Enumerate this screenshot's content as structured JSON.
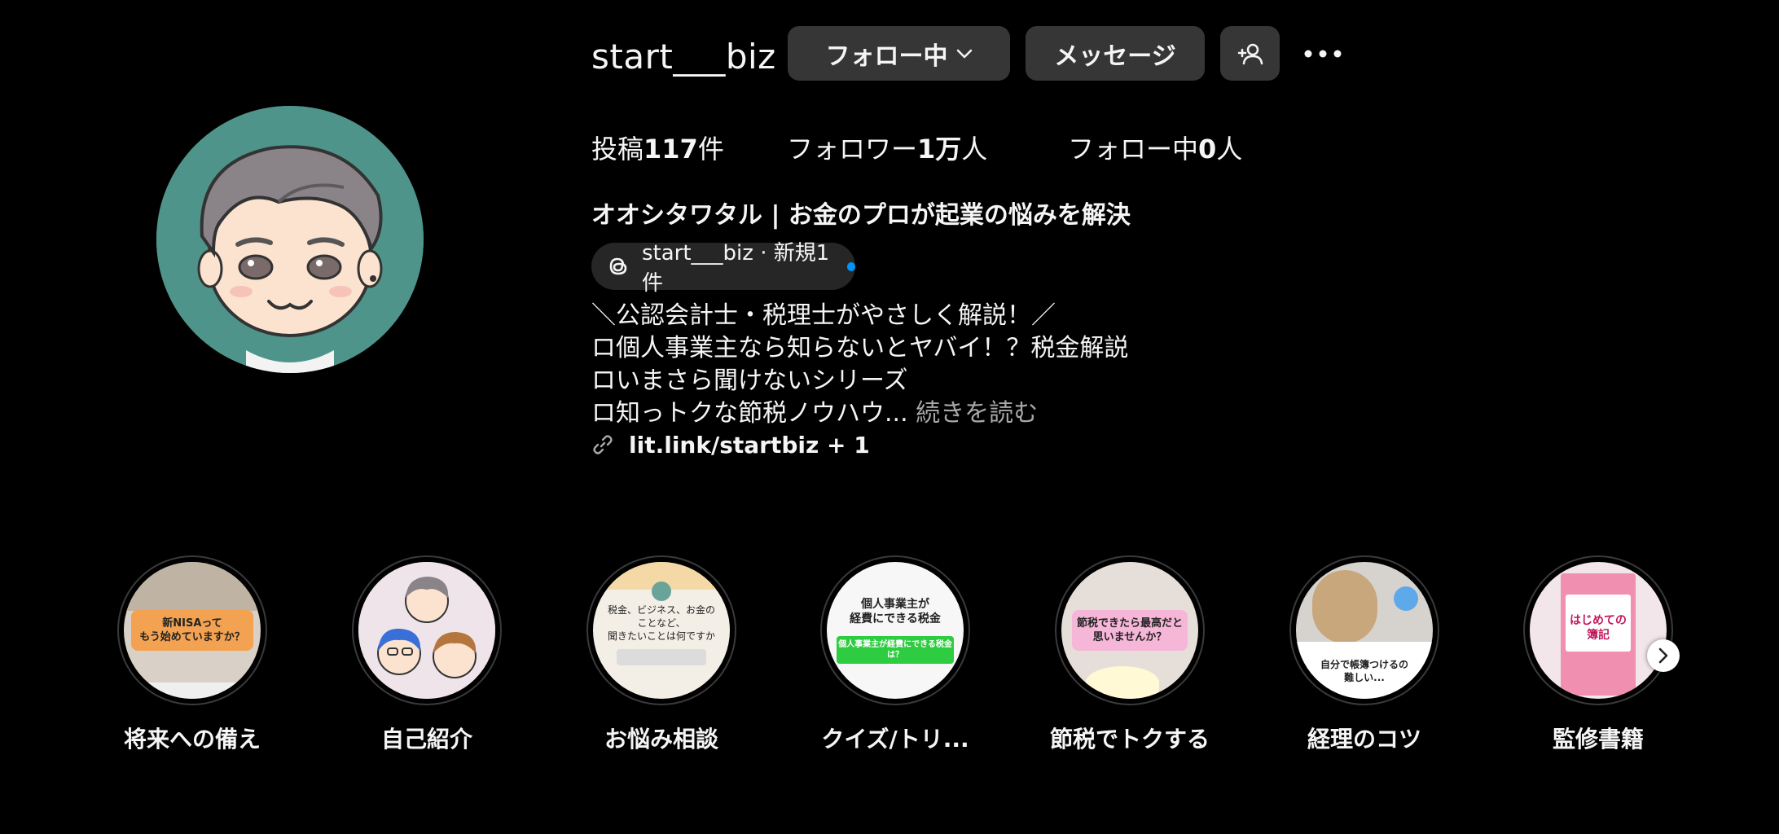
{
  "profile": {
    "username": "start___biz",
    "follow_button": "フォロー中",
    "message_button": "メッセージ",
    "stats": {
      "posts_label": "投稿",
      "posts_count": "117",
      "posts_unit": "件",
      "followers_label": "フォロワー",
      "followers_count": "1万",
      "followers_unit": "人",
      "following_label": "フォロー中",
      "following_count": "0",
      "following_unit": "人"
    },
    "full_name": "オオシタワタル | お金のプロが起業の悩みを解決",
    "threads_badge": "start___biz · 新規1件",
    "bio_lines": [
      "＼公認会計士・税理士がやさしく解説！／",
      "ロ個人事業主なら知らないとヤバイ！？税金解説",
      "ロいまさら聞けないシリーズ",
      "ロ知っトクな節税ノウハウ..."
    ],
    "bio_more": "続きを読む",
    "link": "lit.link/startbiz + 1"
  },
  "highlights": [
    {
      "label": "将来への備え",
      "card_text": "新NISAって\nもう始めていますか？"
    },
    {
      "label": "自己紹介"
    },
    {
      "label": "お悩み相談",
      "card_text": "税金、ビジネス、お金の\nことなど、\n聞きたいことは何ですか"
    },
    {
      "label": "クイズ/トリ...",
      "card_text": "個人事業主が\n経費にできる税金",
      "card_sub": "個人事業主が経費にできる税金は？"
    },
    {
      "label": "節税でトクする",
      "card_text": "節税できたら最高だと\n思いませんか？"
    },
    {
      "label": "経理のコツ",
      "card_text": "自分で帳簿つけるの\n難しい..."
    },
    {
      "label": "監修書籍",
      "card_text": "はじめての\n簿記"
    }
  ],
  "colors": {
    "background": "#000000",
    "button": "#363636",
    "avatar_bg": "#4f948a",
    "accent_dot": "#0095f6",
    "muted_text": "#a8a8a8"
  }
}
